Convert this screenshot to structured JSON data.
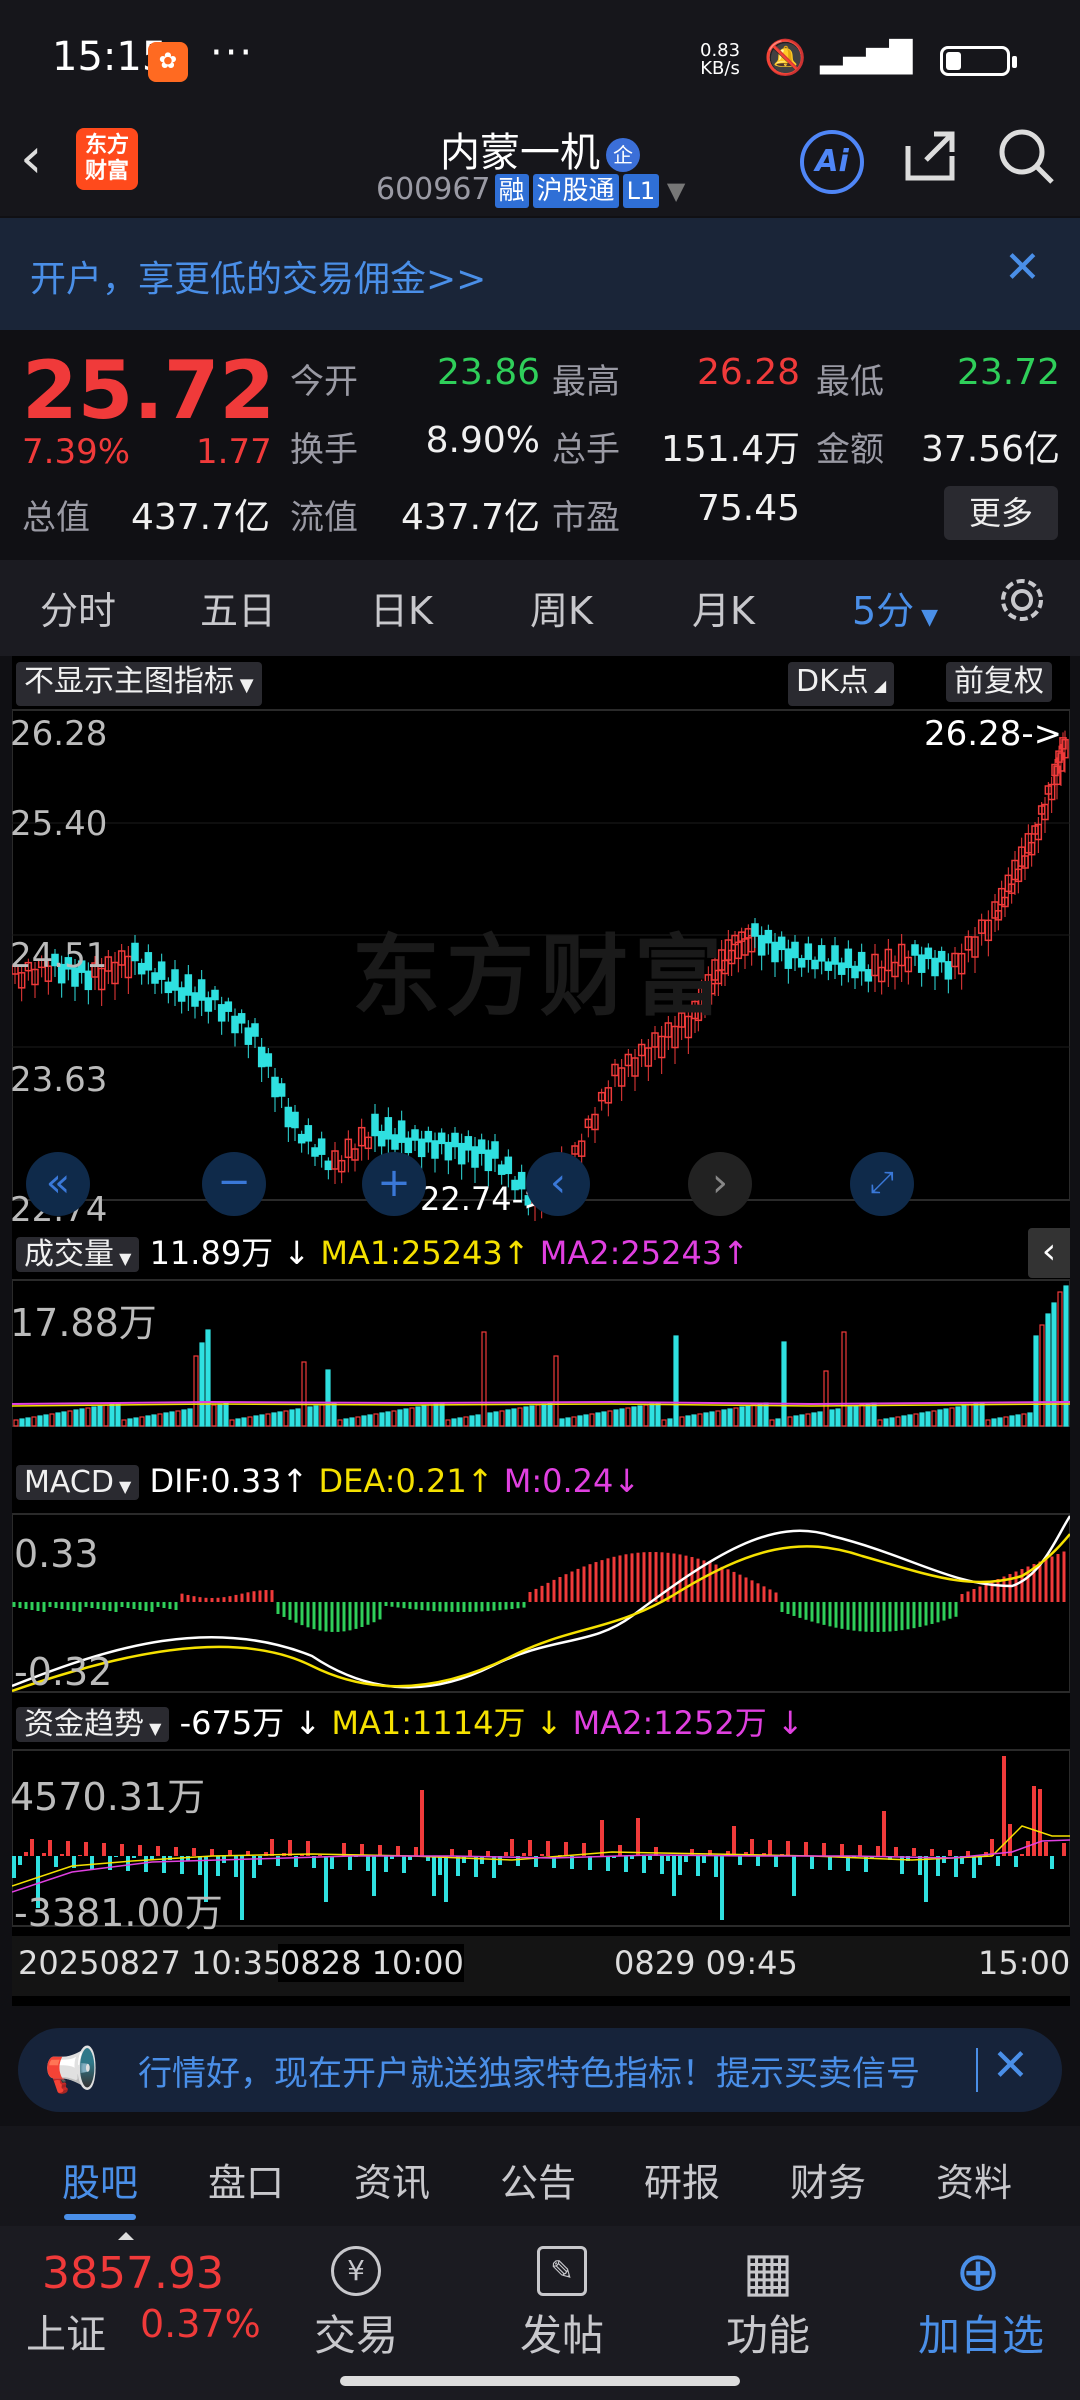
{
  "status": {
    "time": "15:15",
    "dots": "···",
    "speed_top": "0.83",
    "speed_unit": "KB/s",
    "battery_level": 0.25
  },
  "header": {
    "back": "‹",
    "logo_line1": "东方",
    "logo_line2": "财富",
    "title": "内蒙一机",
    "title_badge": "企",
    "code": "600967",
    "tag_rong": "融",
    "tag_hgt": "沪股通",
    "tag_l1": "L1",
    "ai": "Ai"
  },
  "banner": {
    "text": "开户，享更低的交易佣金>>",
    "close": "✕"
  },
  "quote": {
    "price": "25.72",
    "pct": "7.39%",
    "change": "1.77",
    "stats": [
      {
        "label": "今开",
        "value": "23.86",
        "color": "green"
      },
      {
        "label": "最高",
        "value": "26.28",
        "color": "red"
      },
      {
        "label": "最低",
        "value": "23.72",
        "color": "green"
      },
      {
        "label": "换手",
        "value": "8.90%",
        "color": "white"
      },
      {
        "label": "总手",
        "value": "151.4万",
        "color": "white"
      },
      {
        "label": "金额",
        "value": "37.56亿",
        "color": "white"
      },
      {
        "label": "总值",
        "value": "437.7亿",
        "color": "white"
      },
      {
        "label": "流值",
        "value": "437.7亿",
        "color": "white"
      },
      {
        "label": "市盈",
        "value": "75.45",
        "color": "white"
      }
    ],
    "more": "更多"
  },
  "tabs": {
    "items": [
      "分时",
      "五日",
      "日K",
      "周K",
      "月K",
      "5分"
    ],
    "active": 5
  },
  "chart": {
    "main_indicator": "不显示主图指标",
    "dk": "DK点",
    "fq": "前复权",
    "yticks": [
      "26.28",
      "25.40",
      "24.51",
      "23.63",
      "22.74"
    ],
    "high_label": "26.28->",
    "low_label": "22.74->",
    "watermark": "东方财富",
    "vol": {
      "name": "成交量",
      "current": "11.89万",
      "ma1": "MA1:25243",
      "ma2": "MA2:25243",
      "max": "17.88万"
    },
    "macd": {
      "name": "MACD",
      "dif": "DIF:0.33",
      "dea": "DEA:0.21",
      "m": "M:0.24",
      "top": "0.33",
      "bottom": "-0.32"
    },
    "fund": {
      "name": "资金趋势",
      "current": "-675万",
      "ma1": "MA1:1114万",
      "ma2": "MA2:1252万",
      "top": "4570.31万",
      "bottom": "-3381.00万"
    },
    "xlabels": [
      "20250827 10:35",
      "0828 10:00",
      "0829 09:45",
      "15:00"
    ]
  },
  "chart_data": {
    "type": "candlestick",
    "high": 26.28,
    "low": 22.74,
    "ylim": [
      22.74,
      26.28
    ],
    "close_last": 25.72
  },
  "news": {
    "text": "行情好，现在开户就送独家特色指标！提示买卖信号",
    "close": "✕"
  },
  "bottom_tabs": {
    "items": [
      "股吧",
      "盘口",
      "资讯",
      "公告",
      "研报",
      "财务",
      "资料"
    ],
    "active": 0
  },
  "bottombar": {
    "index_value": "3857.93",
    "index_name": "上证",
    "index_pct": "0.37%",
    "actions": [
      {
        "icon": "¥",
        "label": "交易"
      },
      {
        "icon": "✎",
        "label": "发帖"
      },
      {
        "icon": "▦",
        "label": "功能"
      },
      {
        "icon": "⊕",
        "label": "加自选"
      }
    ]
  }
}
